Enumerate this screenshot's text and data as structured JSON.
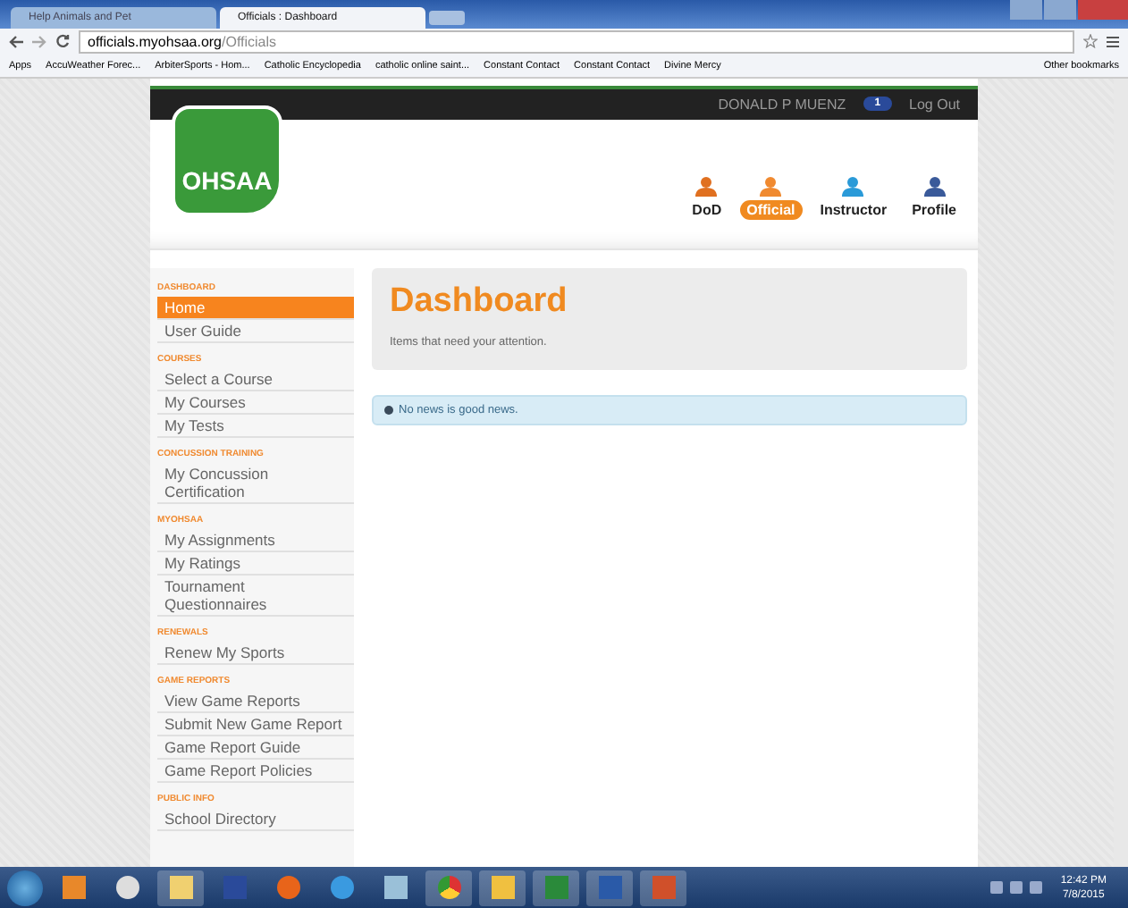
{
  "browser": {
    "tabs": [
      {
        "label": "Help Animals and Pet",
        "selected": false
      },
      {
        "label": "Officials : Dashboard",
        "selected": true
      }
    ],
    "address": {
      "host": "officials.myohsaa.org",
      "path": "/Officials"
    },
    "bookmarks": [
      "Apps",
      "AccuWeather Forec...",
      "ArbiterSports - Hom...",
      "Catholic Encyclopedia",
      "catholic online saint...",
      "Constant Contact",
      "Constant Contact",
      "Divine Mercy"
    ],
    "other_bookmarks": "Other bookmarks"
  },
  "header": {
    "user_name": "DONALD P MUENZ",
    "notification_count": "1",
    "logout": "Log Out",
    "logo_text": "OHSAA",
    "roles": [
      {
        "label": "DoD",
        "selected": false,
        "color": "#e07020"
      },
      {
        "label": "Official",
        "selected": true,
        "color": "#f08a30"
      },
      {
        "label": "Instructor",
        "selected": false,
        "color": "#2a9ad8"
      },
      {
        "label": "Profile",
        "selected": false,
        "color": "#3a5a9a"
      }
    ]
  },
  "sidebar": [
    {
      "heading": "DASHBOARD",
      "items": [
        {
          "label": "Home",
          "selected": true
        },
        {
          "label": "User Guide",
          "selected": false
        }
      ]
    },
    {
      "heading": "COURSES",
      "items": [
        {
          "label": "Select a Course",
          "selected": false
        },
        {
          "label": "My Courses",
          "selected": false
        },
        {
          "label": "My Tests",
          "selected": false
        }
      ]
    },
    {
      "heading": "CONCUSSION TRAINING",
      "items": [
        {
          "label": "My Concussion Certification",
          "selected": false
        }
      ]
    },
    {
      "heading": "MYOHSAA",
      "items": [
        {
          "label": "My Assignments",
          "selected": false
        },
        {
          "label": "My Ratings",
          "selected": false
        },
        {
          "label": "Tournament Questionnaires",
          "selected": false
        }
      ]
    },
    {
      "heading": "RENEWALS",
      "items": [
        {
          "label": "Renew My Sports",
          "selected": false
        }
      ]
    },
    {
      "heading": "GAME REPORTS",
      "items": [
        {
          "label": "View Game Reports",
          "selected": false
        },
        {
          "label": "Submit New Game Report",
          "selected": false
        },
        {
          "label": "Game Report Guide",
          "selected": false
        },
        {
          "label": "Game Report Policies",
          "selected": false
        }
      ]
    },
    {
      "heading": "PUBLIC INFO",
      "items": [
        {
          "label": "School Directory",
          "selected": false
        }
      ]
    }
  ],
  "main": {
    "title": "Dashboard",
    "subtitle": "Items that need your attention.",
    "alert": "No news is good news."
  },
  "taskbar": {
    "time": "12:42 PM",
    "date": "7/8/2015"
  }
}
